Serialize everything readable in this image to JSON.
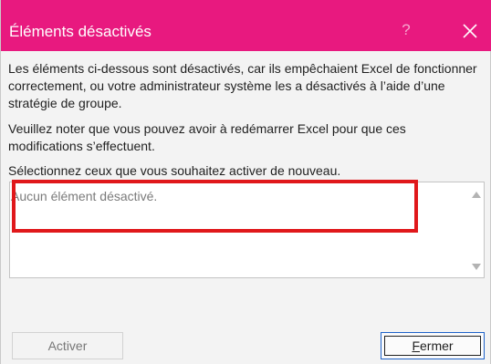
{
  "dialog": {
    "title": "Éléments désactivés",
    "help_glyph": "?",
    "paragraph1": "Les éléments ci-dessous sont désactivés, car ils empêchaient Excel de fonctionner correctement, ou votre administrateur système les a désactivés à l’aide d’une stratégie de groupe.",
    "paragraph2": "Veuillez noter que vous pouvez avoir à redémarrer Excel pour que ces modifications s’effectuent.",
    "paragraph3": "Sélectionnez ceux que vous souhaitez activer de nouveau.",
    "list": {
      "empty_text": "Aucun élément désactivé."
    },
    "buttons": {
      "activate_label": "Activer",
      "close_mnemonic": "F",
      "close_label_rest": "ermer"
    }
  },
  "colors": {
    "titlebar": "#e8197f",
    "highlight": "#e0181b",
    "focus_border": "#1e62c9"
  },
  "icons": {
    "help": "question-mark",
    "close": "x-close"
  }
}
